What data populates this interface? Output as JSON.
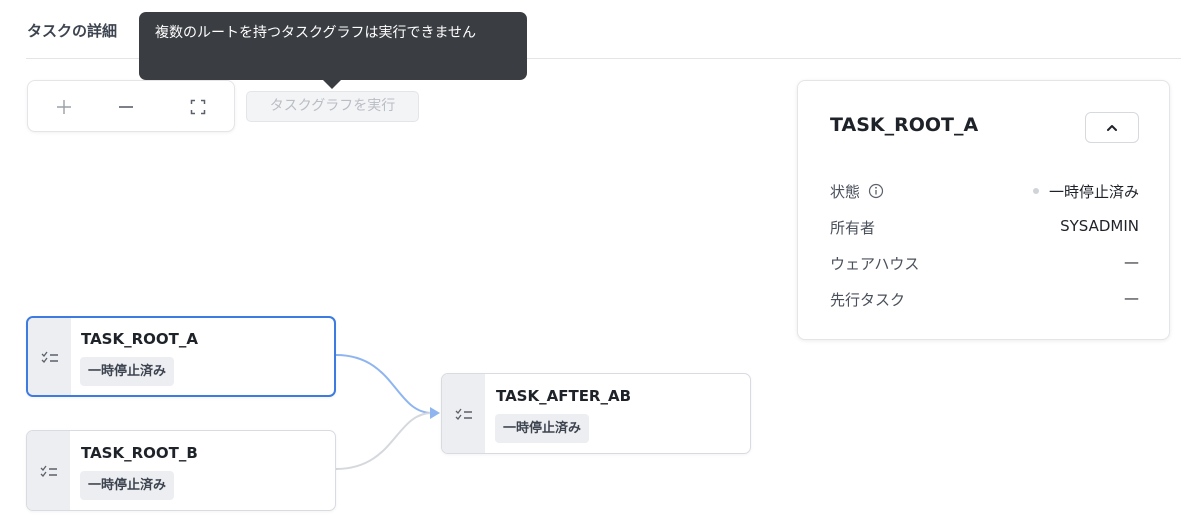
{
  "header": {
    "tab_title": "タスクの詳細"
  },
  "tooltip": {
    "text": "複数のルートを持つタスクグラフは実行できません"
  },
  "toolbar": {
    "zoom_in_icon": "plus-icon",
    "zoom_out_icon": "minus-icon",
    "fit_view_icon": "fit-screen-icon",
    "run_label": "タスクグラフを実行"
  },
  "detail": {
    "title": "TASK_ROOT_A",
    "collapse_icon": "chevron-up-icon",
    "rows": [
      {
        "label": "状態",
        "value": "一時停止済み"
      },
      {
        "label": "所有者",
        "value": "SYSADMIN"
      },
      {
        "label": "ウェアハウス",
        "value": "—"
      },
      {
        "label": "先行タスク",
        "value": "—"
      }
    ]
  },
  "graph": {
    "nodes": [
      {
        "name": "TASK_ROOT_A",
        "status": "一時停止済み",
        "selected": true
      },
      {
        "name": "TASK_ROOT_B",
        "status": "一時停止済み",
        "selected": false
      },
      {
        "name": "TASK_AFTER_AB",
        "status": "一時停止済み",
        "selected": false
      }
    ],
    "node_icon": "task-list-icon"
  },
  "colors": {
    "accent": "#3d7be0",
    "edge_active": "#8fb5f0",
    "edge_inactive": "#d5d8dd",
    "tooltip_bg": "#3a3d42"
  }
}
